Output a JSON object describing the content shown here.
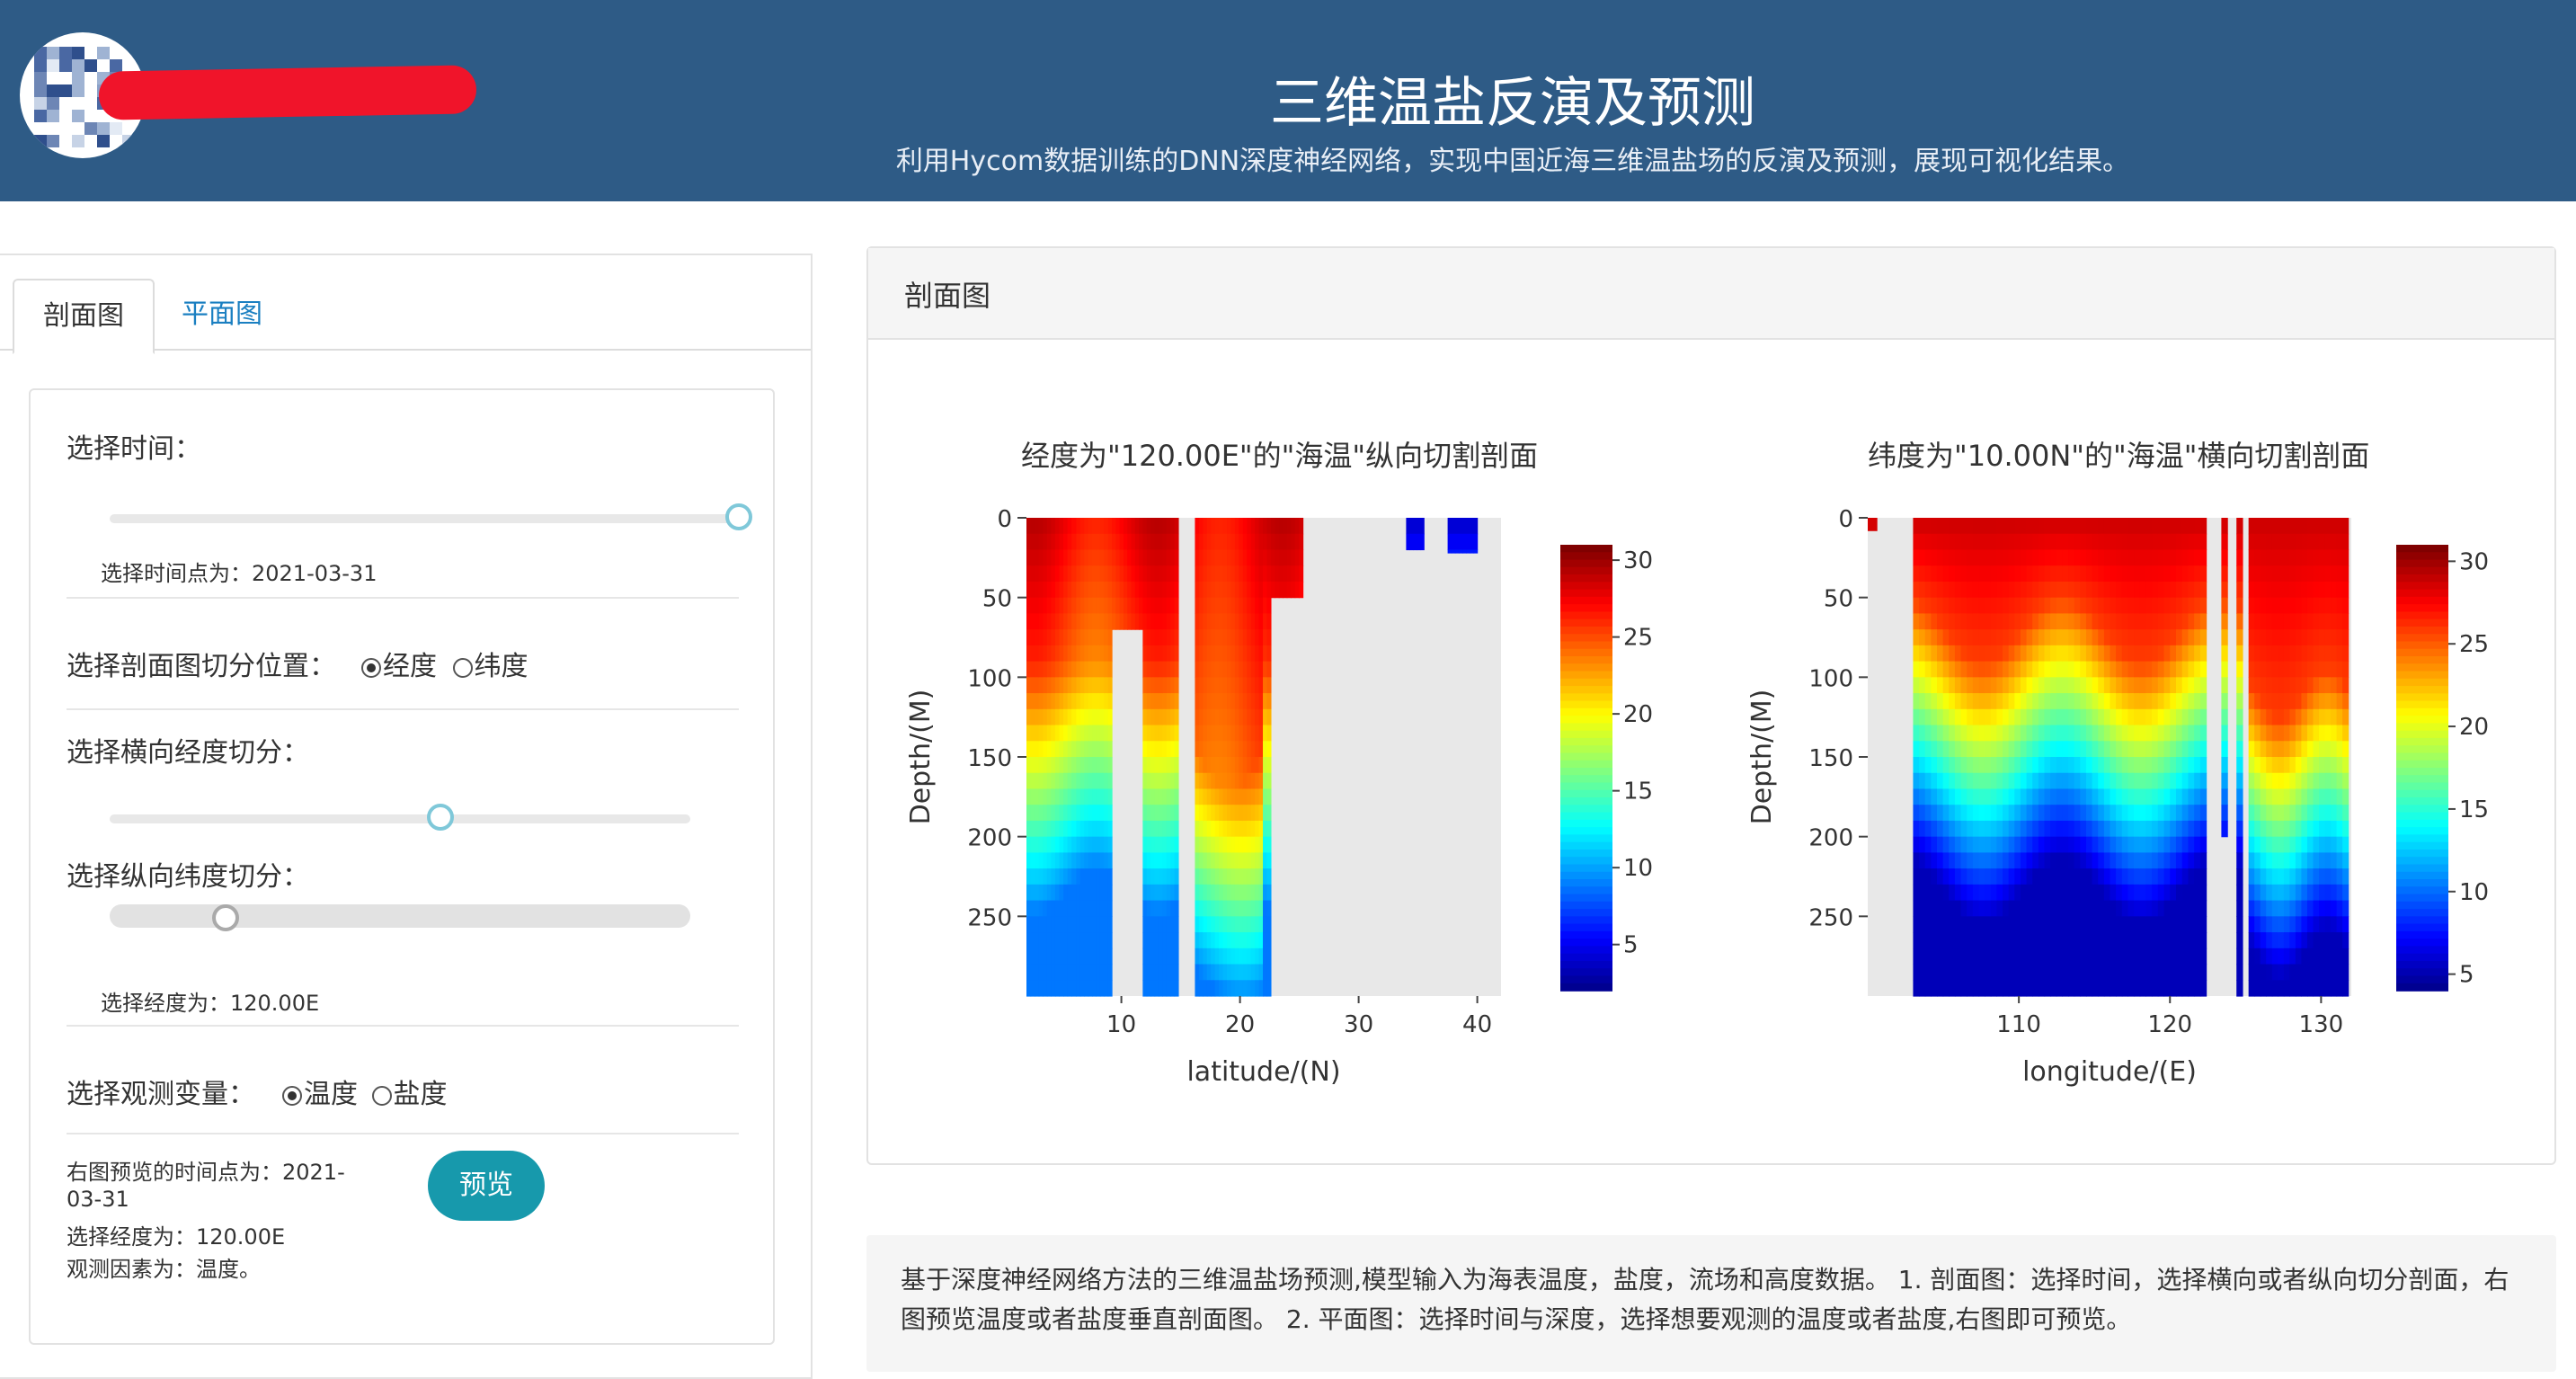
{
  "header": {
    "title": "三维温盐反演及预测",
    "subtitle": "利用Hycom数据训练的DNN深度神经网络，实现中国近海三维温盐场的反演及预测，展现可视化结果。"
  },
  "tabs": [
    {
      "label": "剖面图",
      "active": true
    },
    {
      "label": "平面图",
      "active": false
    }
  ],
  "controls": {
    "time_label": "选择时间：",
    "time_slider_value": 1.0,
    "time_selected": "选择时间点为：2021-03-31",
    "cut_position_label": "选择剖面图切分位置：",
    "cut_options": [
      "经度",
      "纬度"
    ],
    "cut_selected": "经度",
    "lon_cut_label": "选择横向经度切分：",
    "lon_slider_value": 0.57,
    "lat_cut_label": "选择纵向纬度切分：",
    "lat_slider_value": 0.2,
    "lon_selected": "选择经度为：120.00E",
    "variable_label": "选择观测变量：",
    "variable_options": [
      "温度",
      "盐度"
    ],
    "variable_selected": "温度",
    "summary_line1": "右图预览的时间点为：2021-",
    "summary_line2": "03-31",
    "summary_line3": "选择经度为：120.00E",
    "summary_line4": "观测因素为：温度。",
    "preview_button": "预览"
  },
  "right_panel": {
    "title": "剖面图"
  },
  "chart_data": [
    {
      "type": "heatmap",
      "title": "经度为\"120.00E\"的\"海温\"纵向切割剖面",
      "xlabel": "latitude/(N)",
      "ylabel": "Depth/(M)",
      "x_ticks": [
        10,
        20,
        30,
        40
      ],
      "y_ticks": [
        0,
        50,
        100,
        150,
        200,
        250
      ],
      "xlim": [
        2,
        42
      ],
      "ylim": [
        300,
        0
      ],
      "colorbar_ticks": [
        5,
        10,
        15,
        20,
        25,
        30
      ],
      "colorbar_range": [
        2,
        31
      ],
      "colorscale": "jet"
    },
    {
      "type": "heatmap",
      "title": "纬度为\"10.00N\"的\"海温\"横向切割剖面",
      "xlabel": "longitude/(E)",
      "ylabel": "Depth/(M)",
      "x_ticks": [
        110,
        120,
        130
      ],
      "y_ticks": [
        0,
        50,
        100,
        150,
        200,
        250
      ],
      "xlim": [
        100,
        132
      ],
      "ylim": [
        300,
        0
      ],
      "colorbar_ticks": [
        5,
        10,
        15,
        20,
        25,
        30
      ],
      "colorbar_range": [
        4,
        31
      ],
      "colorscale": "jet"
    }
  ],
  "footer": {
    "description": "基于深度神经网络方法的三维温盐场预测,模型输入为海表温度，盐度，流场和高度数据。 1. 剖面图：选择时间，选择横向或者纵向切分剖面，右图预览温度或者盐度垂直剖面图。 2. 平面图：选择时间与深度，选择想要观测的温度或者盐度,右图即可预览。"
  },
  "colors": {
    "header_bg": "#2e5b86",
    "accent": "#1799ac",
    "tab_link": "#1a7fc1",
    "redaction": "#f0142a"
  }
}
